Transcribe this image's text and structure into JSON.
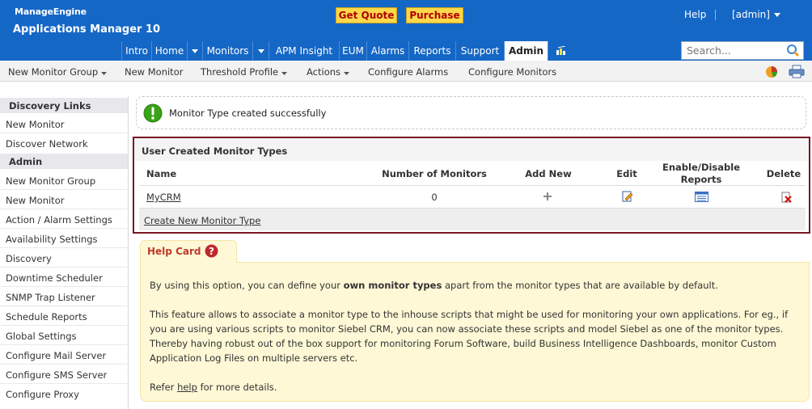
{
  "header": {
    "brand_top": "ManageEngine",
    "brand_app": "Applications Manager 10",
    "get_quote": "Get Quote",
    "purchase": "Purchase",
    "help": "Help",
    "user": "[admin]"
  },
  "nav": {
    "items": [
      "Intro",
      "Home",
      "Monitors",
      "APM Insight",
      "EUM",
      "Alarms",
      "Reports",
      "Support",
      "Admin"
    ],
    "active": "Admin"
  },
  "search": {
    "placeholder": "Search..."
  },
  "subnav": {
    "items": [
      "New Monitor Group",
      "New Monitor",
      "Threshold Profile",
      "Actions",
      "Configure Alarms",
      "Configure Monitors"
    ]
  },
  "sidebar": {
    "discovery_head": "Discovery Links",
    "discovery": [
      "New Monitor",
      "Discover Network"
    ],
    "admin_head": "Admin",
    "admin": [
      "New Monitor Group",
      "New Monitor",
      "Action / Alarm Settings",
      "Availability Settings",
      "Discovery",
      "Downtime Scheduler",
      "SNMP Trap Listener",
      "Schedule Reports",
      "Global Settings",
      "Configure Mail Server",
      "Configure SMS Server",
      "Configure Proxy"
    ]
  },
  "message": {
    "text": "Monitor Type created successfully"
  },
  "table": {
    "title": "User Created Monitor Types",
    "columns": [
      "Name",
      "Number of Monitors",
      "Add New",
      "Edit",
      "Enable/Disable Reports",
      "Delete"
    ],
    "rows": [
      {
        "name": "MyCRM",
        "count": "0"
      }
    ],
    "create_link": "Create New Monitor Type"
  },
  "help": {
    "title": "Help Card",
    "p1_a": "By using this option, you can define your ",
    "p1_b": "own monitor types",
    "p1_c": " apart from the monitor types that are available by default.",
    "p2_l1": "This feature allows to associate a monitor type to the inhouse scripts that might be used for monitoring your own applications. For eg., if",
    "p2_l2": "you are using various scripts to monitor Siebel CRM, you can now associate these scripts and model Siebel as one of the monitor types.",
    "p2_l3": "Thereby having robust out of the box support for monitoring Forum Software, build Business Intelligence Dashboards, monitor Custom",
    "p2_l4": "Application Log Files on multiple servers etc.",
    "p3_a": "Refer ",
    "p3_link": "help",
    "p3_b": " for more details."
  },
  "colors": {
    "brand_blue": "#1567c6",
    "panel_border": "#7a1522",
    "success_green": "#3aa317",
    "help_bg": "#fef8d6"
  }
}
